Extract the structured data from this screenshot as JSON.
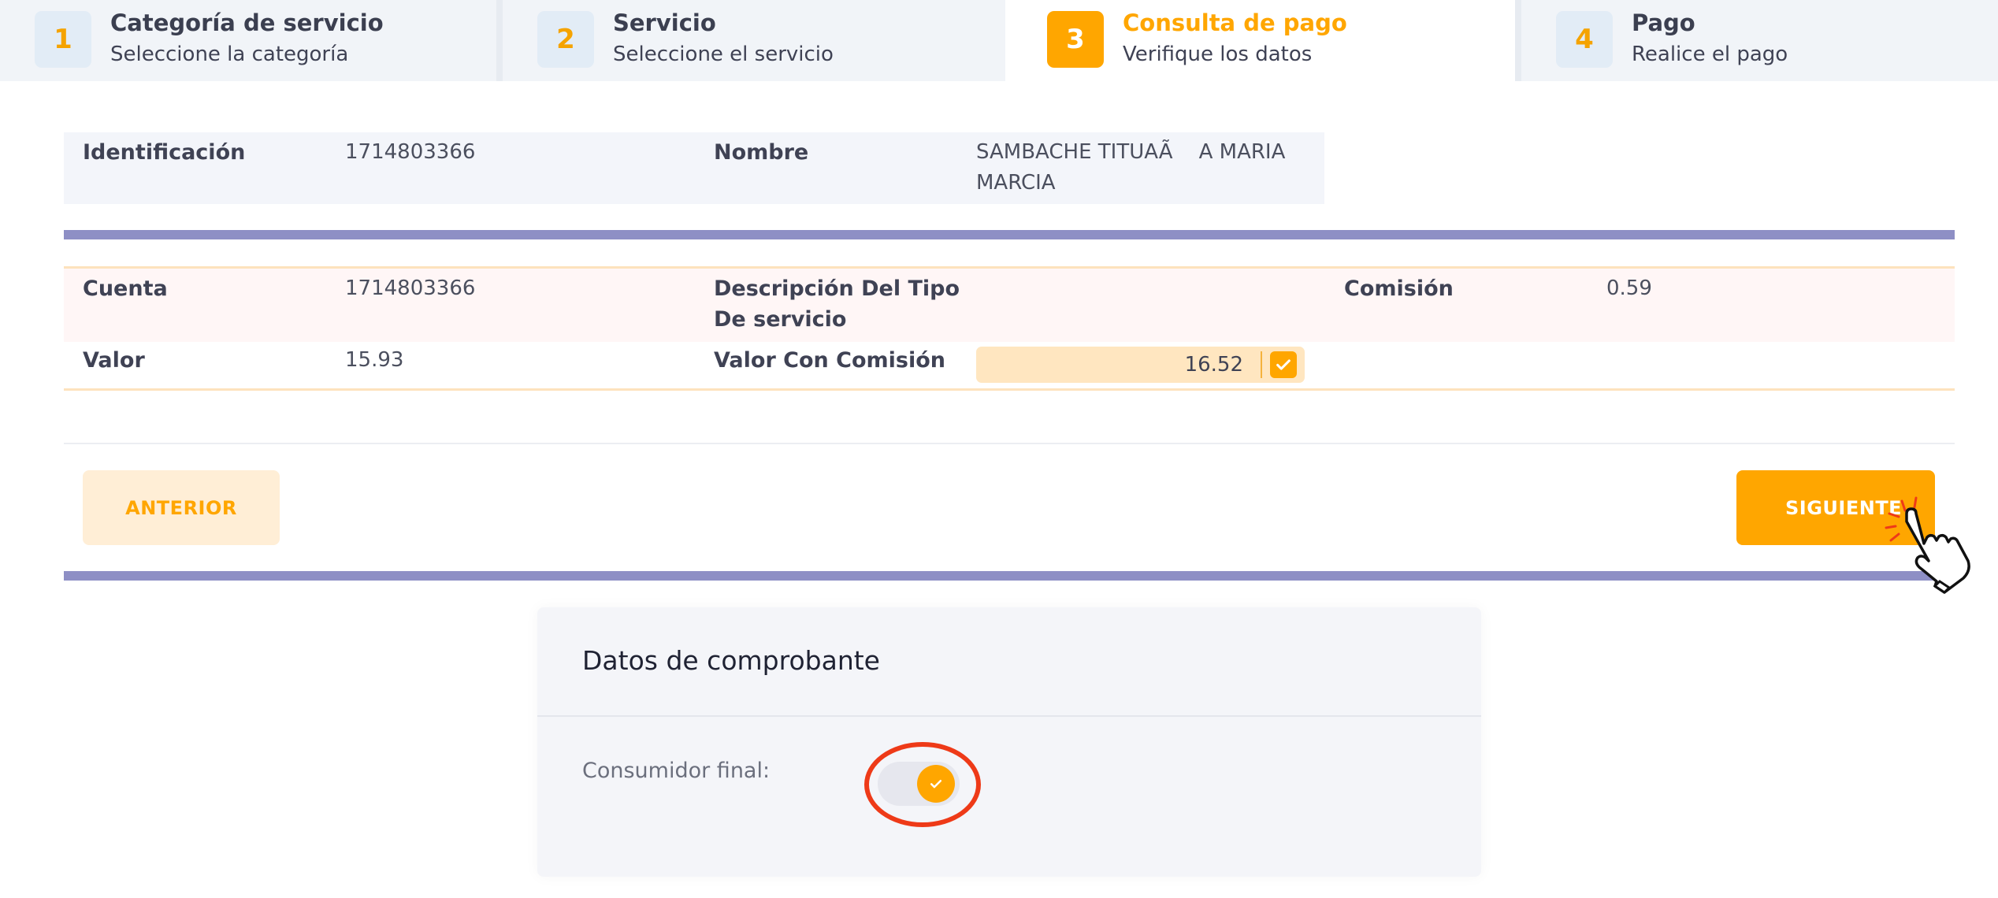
{
  "stepper": {
    "steps": [
      {
        "number": "1",
        "title": "Categoría de servicio",
        "subtitle": "Seleccione la categoría",
        "active": false
      },
      {
        "number": "2",
        "title": "Servicio",
        "subtitle": "Seleccione el servicio",
        "active": false
      },
      {
        "number": "3",
        "title": "Consulta de pago",
        "subtitle": "Verifique los datos",
        "active": true
      },
      {
        "number": "4",
        "title": "Pago",
        "subtitle": "Realice el pago",
        "active": false
      }
    ]
  },
  "client": {
    "id_label": "Identificación",
    "id_value": "1714803366",
    "name_label": "Nombre",
    "name_value_line1": "SAMBACHE TITUAÃ    A MARIA",
    "name_value_line2": "MARCIA"
  },
  "payment": {
    "account_label": "Cuenta",
    "account_value": "1714803366",
    "desc_label_line1": "Descripción Del Tipo",
    "desc_label_line2": "De servicio",
    "commission_label": "Comisión",
    "commission_value": "0.59",
    "value_label": "Valor",
    "value_value": "15.93",
    "value_with_commission_label": "Valor Con Comisión",
    "value_with_commission_value": "16.52"
  },
  "buttons": {
    "previous": "ANTERIOR",
    "next": "SIGUIENTE"
  },
  "voucher": {
    "title": "Datos de comprobante",
    "final_consumer_label": "Consumidor final:",
    "final_consumer_enabled": true
  },
  "colors": {
    "accent": "#ffa600",
    "divider": "#8e8fc5",
    "highlight_ring": "#ee3a18"
  }
}
